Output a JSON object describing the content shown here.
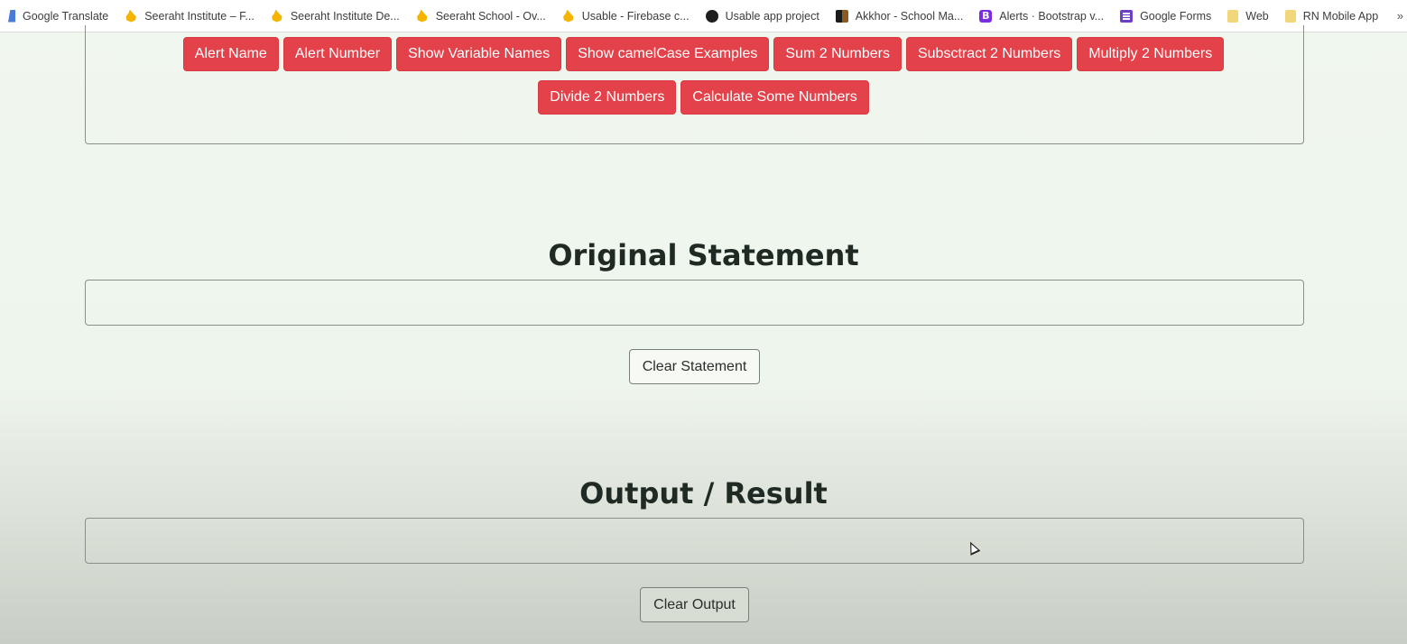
{
  "bookmarks": [
    {
      "label": "Google Translate",
      "icon": "google-translate-icon"
    },
    {
      "label": "Seeraht Institute – F...",
      "icon": "firebase-icon"
    },
    {
      "label": "Seeraht Institute De...",
      "icon": "firebase-icon"
    },
    {
      "label": "Seeraht School - Ov...",
      "icon": "firebase-icon"
    },
    {
      "label": "Usable - Firebase c...",
      "icon": "firebase-icon"
    },
    {
      "label": "Usable app project",
      "icon": "github-icon"
    },
    {
      "label": "Akkhor - School Ma...",
      "icon": "akkhor-icon"
    },
    {
      "label": "Alerts · Bootstrap v...",
      "icon": "bootstrap-icon",
      "icon_text": "B"
    },
    {
      "label": "Google Forms",
      "icon": "google-forms-icon"
    },
    {
      "label": "Web",
      "icon": "folder-icon"
    },
    {
      "label": "RN Mobile App",
      "icon": "folder-icon"
    }
  ],
  "bookmarks_overflow": "»",
  "actions": {
    "row1": [
      "Alert Name",
      "Alert Number",
      "Show Variable Names",
      "Show camelCase Examples",
      "Sum 2 Numbers",
      "Subsctract 2 Numbers",
      "Multiply 2 Numbers"
    ],
    "row2": [
      "Divide 2 Numbers",
      "Calculate Some Numbers"
    ],
    "button_color": "#e4424a"
  },
  "original": {
    "heading": "Original Statement",
    "value": "",
    "clear_label": "Clear Statement"
  },
  "output": {
    "heading": "Output / Result",
    "value": "",
    "clear_label": "Clear Output"
  }
}
